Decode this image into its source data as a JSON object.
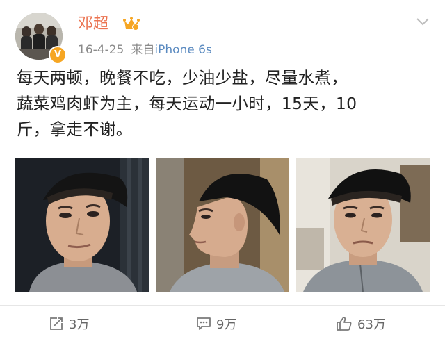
{
  "post": {
    "username": "邓超",
    "avatar_badge": "V",
    "date": "16-4-25",
    "source_prefix": "来自",
    "source_device": "iPhone 6s",
    "text_lines": [
      "每天两顿，晚餐不吃，少油少盐，尽量水煮，",
      "蔬菜鸡肉虾为主，每天运动一小时，15天，10",
      "斤，拿走不谢。"
    ],
    "photos": [
      "selfie-photo-1",
      "selfie-photo-2",
      "selfie-photo-3"
    ]
  },
  "actions": {
    "repost_count": "3万",
    "comment_count": "9万",
    "like_count": "63万"
  },
  "colors": {
    "username": "#eb7350",
    "meta": "#8a8a8a",
    "device": "#5a8ac0",
    "text": "#222222",
    "badge": "#f6a623",
    "actions": "#666666"
  },
  "icons": {
    "menu": "chevron-down-icon",
    "repost": "share-icon",
    "comment": "comment-icon",
    "like": "thumbs-up-icon",
    "vip": "verified-badge-icon",
    "crown": "crown-badge-icon"
  }
}
